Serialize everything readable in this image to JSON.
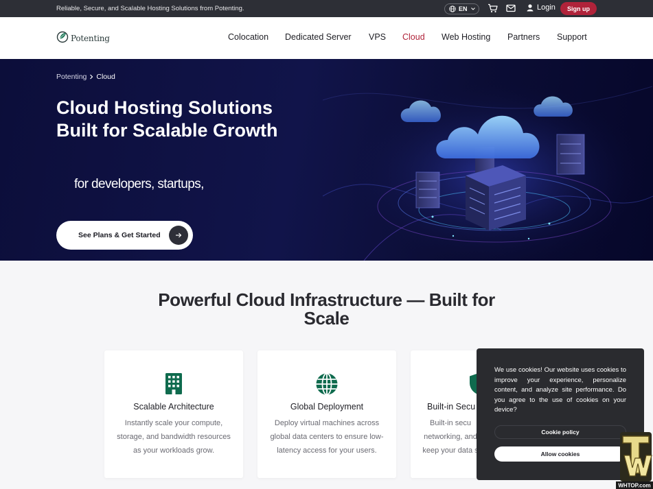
{
  "topbar": {
    "tagline": "Reliable, Secure, and Scalable Hosting Solutions from Potenting.",
    "language": "EN",
    "login": "Login",
    "signup": "Sign up"
  },
  "brand": {
    "name": "Potenting"
  },
  "nav": {
    "items": [
      "Colocation",
      "Dedicated Server",
      "VPS",
      "Cloud",
      "Web Hosting",
      "Partners",
      "Support"
    ],
    "active": "Cloud"
  },
  "hero": {
    "breadcrumb": [
      "Potenting",
      "Cloud"
    ],
    "title": "Cloud Hosting Solutions Built for Scalable Growth",
    "subtitle": "for developers, startups,",
    "cta": "See Plans & Get Started"
  },
  "section": {
    "title": "Powerful Cloud Infrastructure — Built for Scale",
    "cards": [
      {
        "title": "Scalable Architecture",
        "desc": "Instantly scale your compute, storage, and bandwidth resources as your workloads grow.",
        "icon": "building-icon"
      },
      {
        "title": "Global Deployment",
        "desc": "Deploy virtual machines across global data centers to ensure low-latency access for your users.",
        "icon": "globe-icon"
      },
      {
        "title": "Built-in Secu",
        "desc": "Built-in secu networking, and keep your data s",
        "icon": "shield-icon"
      }
    ]
  },
  "cookie": {
    "text": "We use cookies! Our website uses cookies to improve your experience, personalize content, and analyze site performance. Do you agree to the use of cookies on your device?",
    "policy": "Cookie policy",
    "allow": "Allow cookies"
  },
  "watermark": {
    "text": "WHTOP.com"
  },
  "colors": {
    "accent": "#b0233a",
    "icon_green": "#0f6b4e",
    "hero_bg": "#0c0e3a",
    "topbar_bg": "#2d2f36"
  }
}
